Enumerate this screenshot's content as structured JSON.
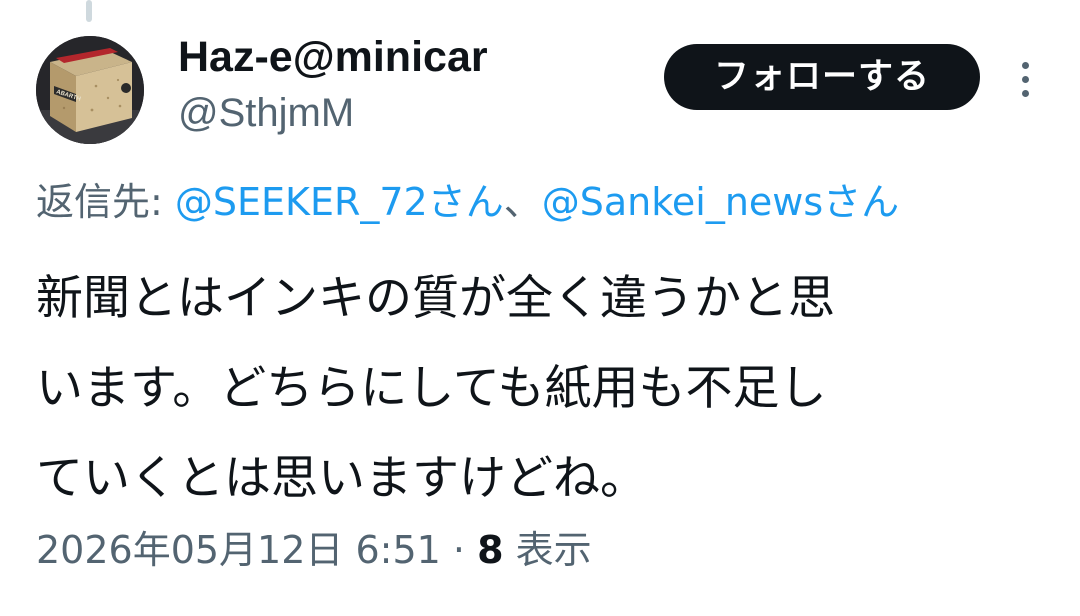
{
  "author": {
    "display_name": "Haz-e@minicar",
    "handle": "@SthjmM",
    "avatar_text": "ABARTH"
  },
  "actions": {
    "follow_label": "フォローする",
    "more_icon": "more-vertical-icon"
  },
  "reply": {
    "prefix": "返信先: ",
    "mention_1": "@SEEKER_72さん",
    "separator": "、",
    "mention_2": "@Sankei_newsさん"
  },
  "tweet": {
    "lines": [
      "新聞とはインキの質が全く違うかと思",
      "います。どちらにしても紙用も不足し",
      "ていくとは思いますけどね。"
    ]
  },
  "meta": {
    "timestamp": "2026年05月12日 6:51",
    "dot": " · ",
    "views_count": "8",
    "views_label": " 表示"
  },
  "colors": {
    "text_primary": "#0f1419",
    "text_secondary": "#536471",
    "link": "#1d9bf0",
    "button_bg": "#0f1419"
  }
}
